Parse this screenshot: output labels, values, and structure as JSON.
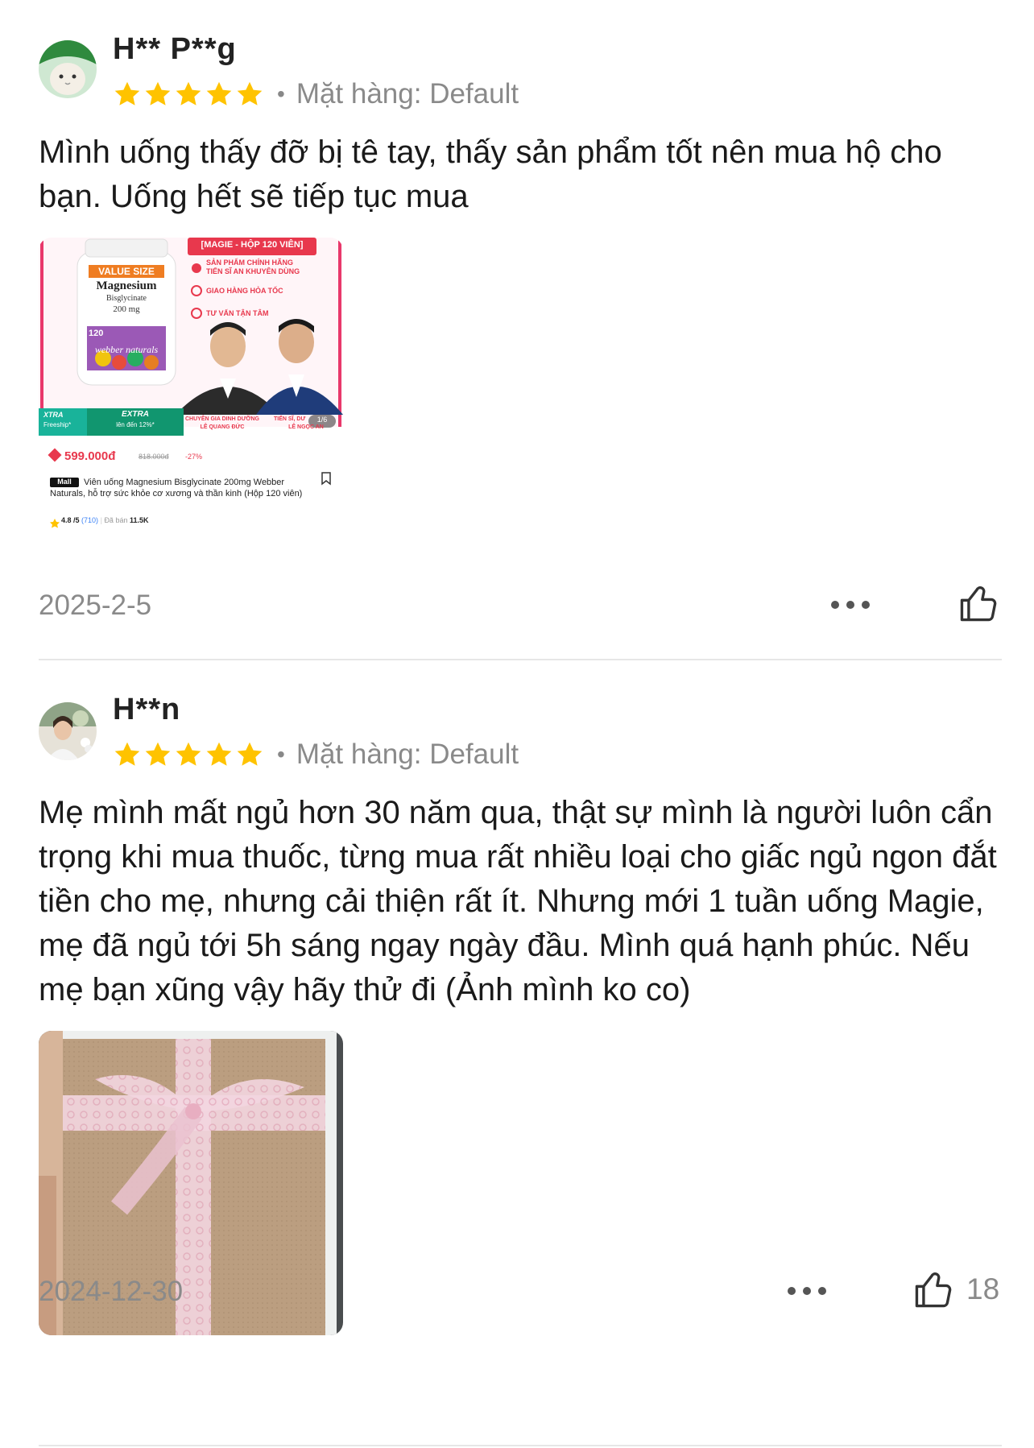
{
  "reviews": [
    {
      "author": "H** P**g",
      "rating": 5,
      "variant_label": "Mặt hàng: Default",
      "text": "Mình uống thấy đỡ bị tê tay, thấy sản phẩm tốt nên mua hộ cho bạn. Uống hết sẽ tiếp tục mua",
      "date": "2025-2-5",
      "likes": "",
      "photo": {
        "banner_title": "[MAGIE - HỘP 120 VIÊN]",
        "feature_1": "SẢN PHẨM CHÍNH HÃNG",
        "feature_1b": "TIẾN SĨ AN KHUYÊN DÙNG",
        "feature_2": "GIAO HÀNG HỎA TỐC",
        "feature_3": "TƯ VẤN TẬN TÂM",
        "bottle_badge": "VALUE SIZE",
        "bottle_name": "Magnesium",
        "bottle_sub": "Bisglycinate",
        "bottle_dose": "200 mg",
        "bottle_count": "120",
        "bottle_brand": "webber naturals",
        "xtra_label": "XTRA",
        "xtra_sub": "Freeship*",
        "extra_label": "EXTRA",
        "extra_sub": "lên đến 12%*",
        "expert_1_title": "CHUYÊN GIA DINH DƯỠNG",
        "expert_1_name": "LÊ QUANG ĐỨC",
        "expert_2_title": "TIẾN SĨ, DƯ",
        "expert_2_name": "LÊ NGỌC AN",
        "page_indicator": "1/6",
        "price": "599.000đ",
        "old_price": "818.000đ",
        "discount": "-27%",
        "mall_badge": "Mall",
        "product_name": "Viên uống Magnesium Bisglycinate 200mg Webber Naturals, hỗ trợ sức khỏe cơ xương và thần kinh (Hộp 120 viên)",
        "product_rating": "4.8 /5",
        "product_reviews": "(710)",
        "sold": "Đã bán",
        "sold_count": "11.5K"
      }
    },
    {
      "author": "H**n",
      "rating": 5,
      "variant_label": "Mặt hàng: Default",
      "text": "Mẹ mình mất ngủ hơn 30 năm qua, thật sự mình là người luôn cẩn trọng khi mua thuốc, từng mua rất nhiều loại cho giấc ngủ ngon đắt tiền cho mẹ, nhưng cải thiện rất ít. Nhưng mới 1 tuần uống Magie, mẹ đã ngủ tới 5h sáng ngay ngày đầu. Mình quá hạnh phúc. Nếu mẹ bạn xũng vậy hãy thử đi (Ảnh mình ko co)",
      "date": "2024-12-30",
      "likes": "18"
    }
  ],
  "icons": {
    "star": "star-icon",
    "more": "more-dots-icon",
    "like": "thumbs-up-icon"
  },
  "colors": {
    "star": "#FFC300",
    "muted_text": "#8a8a8a",
    "price_red": "#e8384d"
  }
}
